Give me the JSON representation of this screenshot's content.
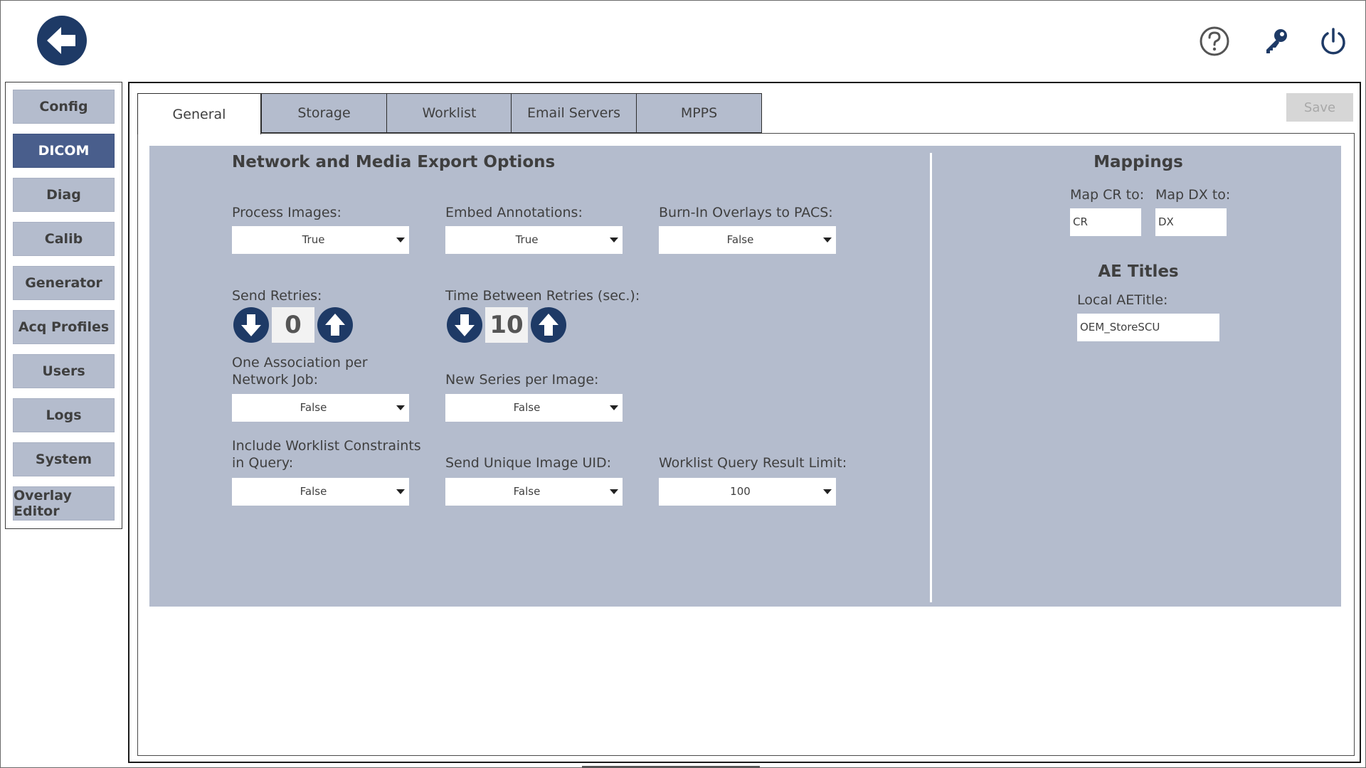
{
  "nav": {
    "items": [
      {
        "label": "Config"
      },
      {
        "label": "DICOM"
      },
      {
        "label": "Diag"
      },
      {
        "label": "Calib"
      },
      {
        "label": "Generator"
      },
      {
        "label": "Acq Profiles"
      },
      {
        "label": "Users"
      },
      {
        "label": "Logs"
      },
      {
        "label": "System"
      },
      {
        "label": "Overlay Editor"
      }
    ],
    "active": "DICOM"
  },
  "topbar": {
    "back_icon": "back-arrow-icon",
    "help_icon": "help-icon",
    "key_icon": "key-icon",
    "power_icon": "power-icon"
  },
  "tabs": [
    {
      "label": "General"
    },
    {
      "label": "Storage"
    },
    {
      "label": "Worklist"
    },
    {
      "label": "Email Servers"
    },
    {
      "label": "MPPS"
    }
  ],
  "save_label": "Save",
  "general": {
    "section_title": "Network and Media Export Options",
    "process_images": {
      "label": "Process Images:",
      "value": "True"
    },
    "embed_annotations": {
      "label": "Embed Annotations:",
      "value": "True"
    },
    "burn_in_overlays": {
      "label": "Burn-In Overlays to PACS:",
      "value": "False"
    },
    "send_retries": {
      "label": "Send Retries:",
      "value": "0"
    },
    "time_between_retries": {
      "label": "Time Between Retries (sec.):",
      "value": "10"
    },
    "one_association": {
      "label_line1": "One Association per",
      "label_line2": "Network Job:",
      "value": "False"
    },
    "new_series": {
      "label": "New Series per Image:",
      "value": "False"
    },
    "include_worklist": {
      "label_line1": "Include Worklist Constraints",
      "label_line2": "in Query:",
      "value": "False"
    },
    "send_unique_uid": {
      "label": "Send Unique Image UID:",
      "value": "False"
    },
    "worklist_limit": {
      "label": "Worklist Query Result Limit:",
      "value": "100"
    }
  },
  "mappings": {
    "title": "Mappings",
    "map_cr_label": "Map CR to:",
    "map_cr_value": "CR",
    "map_dx_label": "Map DX to:",
    "map_dx_value": "DX"
  },
  "ae_titles": {
    "title": "AE Titles",
    "local_label": "Local AETitle:",
    "local_value": "OEM_StoreSCU"
  },
  "colors": {
    "accent_dark": "#1e3a66",
    "panel_bg": "#b4bccd",
    "nav_active": "#495e8c"
  }
}
